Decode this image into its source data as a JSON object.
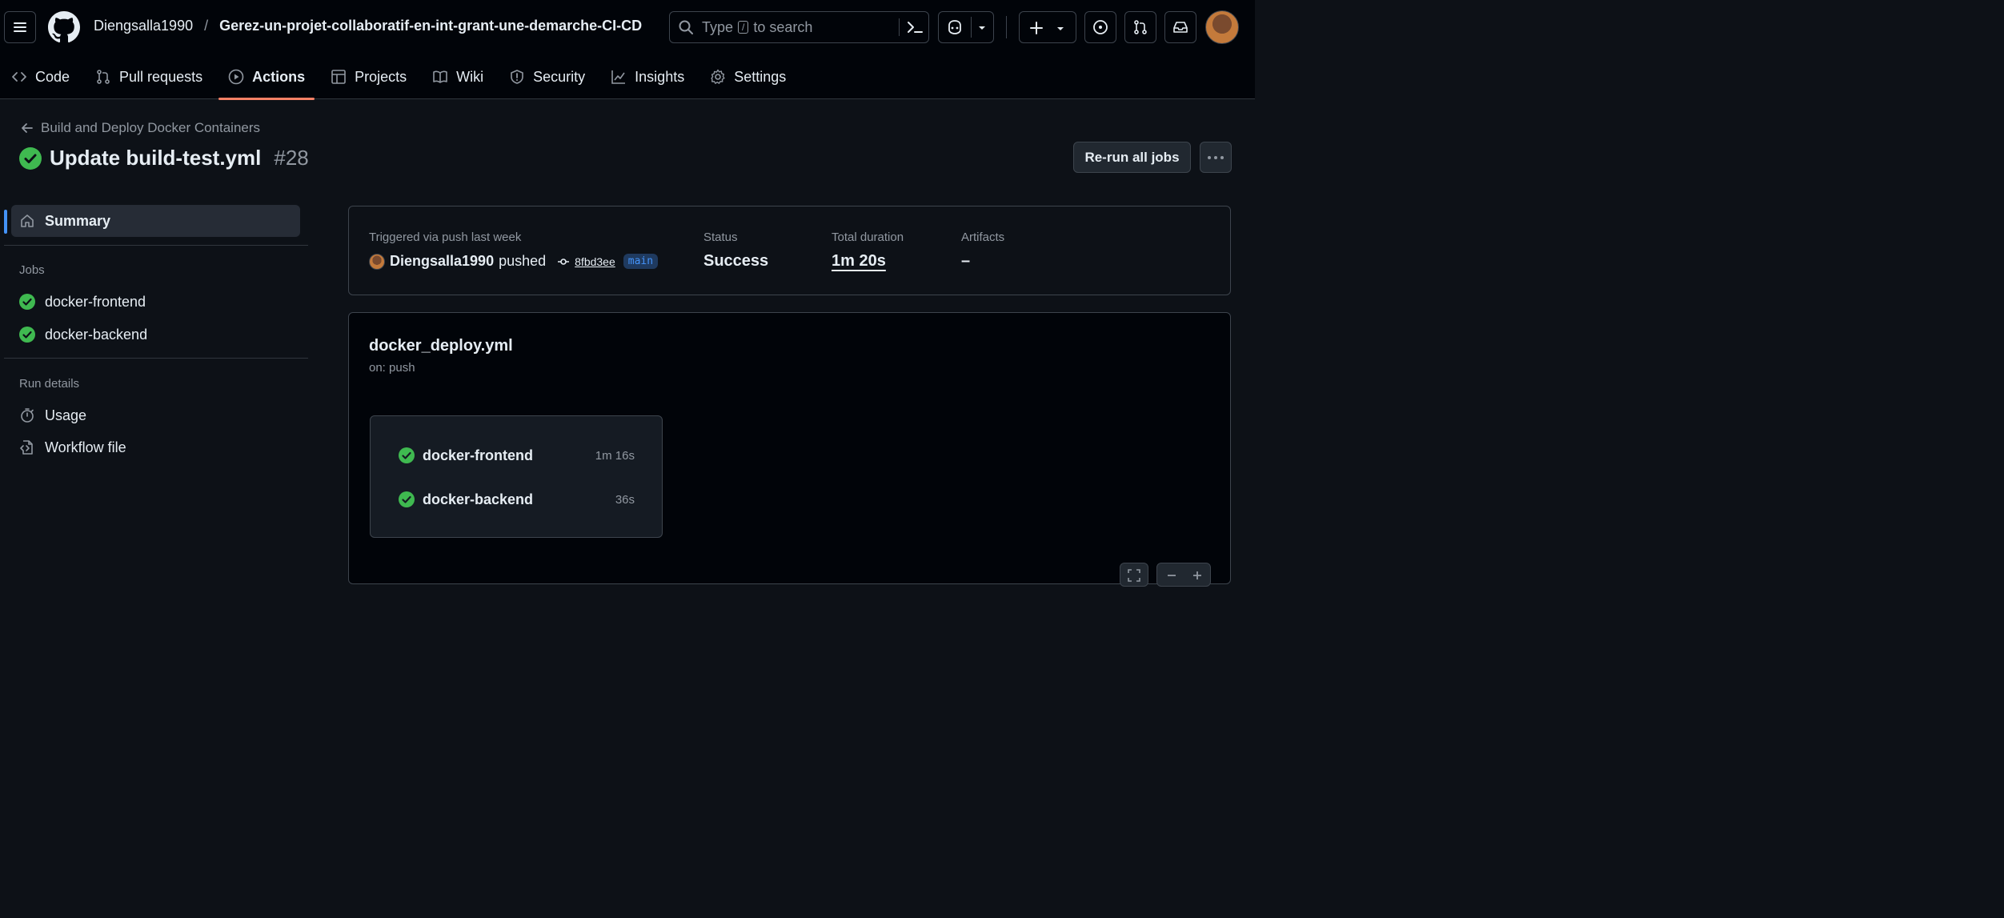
{
  "header": {
    "owner": "Diengsalla1990",
    "separator": "/",
    "repo": "Gerez-un-projet-collaboratif-en-int-grant-une-demarche-CI-CD",
    "search_prefix": "Type",
    "search_key": "/",
    "search_suffix": "to search"
  },
  "tabs": [
    {
      "label": "Code",
      "icon": "code-icon"
    },
    {
      "label": "Pull requests",
      "icon": "pull-request-icon"
    },
    {
      "label": "Actions",
      "icon": "play-icon",
      "active": true
    },
    {
      "label": "Projects",
      "icon": "table-icon"
    },
    {
      "label": "Wiki",
      "icon": "book-icon"
    },
    {
      "label": "Security",
      "icon": "shield-icon"
    },
    {
      "label": "Insights",
      "icon": "graph-icon"
    },
    {
      "label": "Settings",
      "icon": "gear-icon"
    }
  ],
  "run": {
    "workflow_name": "Build and Deploy Docker Containers",
    "title": "Update build-test.yml",
    "number": "#28",
    "rerun_label": "Re-run all jobs"
  },
  "sidebar": {
    "summary_label": "Summary",
    "jobs_heading": "Jobs",
    "jobs": [
      "docker-frontend",
      "docker-backend"
    ],
    "run_details_heading": "Run details",
    "usage_label": "Usage",
    "workflow_file_label": "Workflow file"
  },
  "summary": {
    "trigger_label": "Triggered via push last week",
    "actor": "Diengsalla1990",
    "action": "pushed",
    "commit": "8fbd3ee",
    "branch": "main",
    "status_label": "Status",
    "status_value": "Success",
    "duration_label": "Total duration",
    "duration_value": "1m 20s",
    "artifacts_label": "Artifacts",
    "artifacts_value": "–"
  },
  "workflow": {
    "file": "docker_deploy.yml",
    "trigger": "on: push",
    "jobs": [
      {
        "name": "docker-frontend",
        "time": "1m 16s"
      },
      {
        "name": "docker-backend",
        "time": "36s"
      }
    ]
  },
  "colors": {
    "success": "#3fb950",
    "accent": "#4493f8",
    "tab_underline": "#f78166"
  }
}
